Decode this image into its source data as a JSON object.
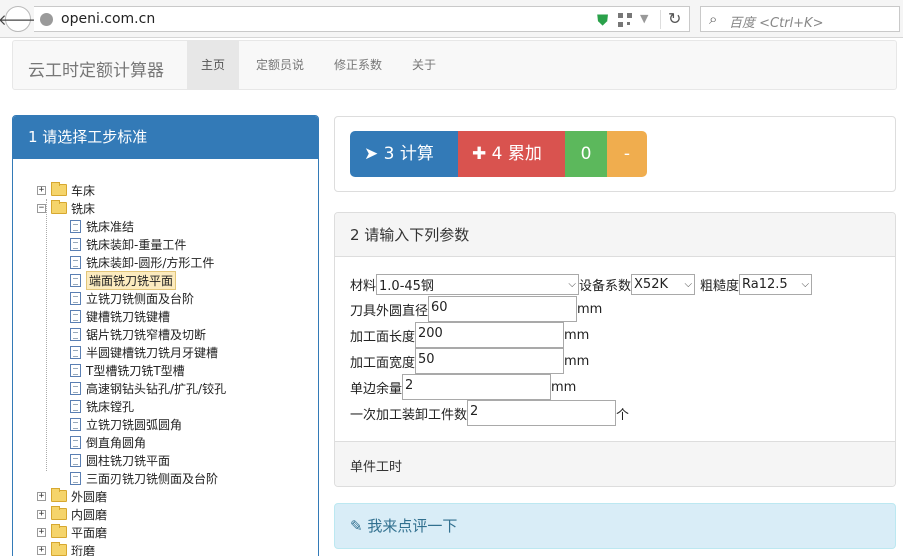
{
  "browser": {
    "url": "openi.com.cn",
    "search_placeholder": "百度 <Ctrl+K>"
  },
  "navbar": {
    "brand": "云工时定额计算器",
    "items": [
      "主页",
      "定额员说",
      "修正系数",
      "关于"
    ],
    "active_index": 0
  },
  "left": {
    "title": "1 请选择工步标准",
    "tree": [
      {
        "label": "车床",
        "type": "folder",
        "expanded": false
      },
      {
        "label": "铣床",
        "type": "folder",
        "expanded": true
      },
      {
        "label": "铣床准结",
        "type": "leaf"
      },
      {
        "label": "铣床装卸-重量工件",
        "type": "leaf"
      },
      {
        "label": "铣床装卸-圆形/方形工件",
        "type": "leaf"
      },
      {
        "label": "端面铣刀铣平面",
        "type": "leaf",
        "selected": true
      },
      {
        "label": "立铣刀铣侧面及台阶",
        "type": "leaf"
      },
      {
        "label": "键槽铣刀铣键槽",
        "type": "leaf"
      },
      {
        "label": "锯片铣刀铣窄槽及切断",
        "type": "leaf"
      },
      {
        "label": "半圆键槽铣刀铣月牙键槽",
        "type": "leaf"
      },
      {
        "label": "T型槽铣刀铣T型槽",
        "type": "leaf"
      },
      {
        "label": "高速钢钻头钻孔/扩孔/铰孔",
        "type": "leaf"
      },
      {
        "label": "铣床镗孔",
        "type": "leaf"
      },
      {
        "label": "立铣刀铣圆弧圆角",
        "type": "leaf"
      },
      {
        "label": "倒直角圆角",
        "type": "leaf"
      },
      {
        "label": "圆柱铣刀铣平面",
        "type": "leaf"
      },
      {
        "label": "三面刃铣刀铣侧面及台阶",
        "type": "leaf"
      },
      {
        "label": "外圆磨",
        "type": "folder",
        "expanded": false
      },
      {
        "label": "内圆磨",
        "type": "folder",
        "expanded": false
      },
      {
        "label": "平面磨",
        "type": "folder",
        "expanded": false
      },
      {
        "label": "珩磨",
        "type": "folder",
        "expanded": false
      }
    ]
  },
  "calc": {
    "calc_label": "3 计算",
    "add_label": "4 累加",
    "count": "0",
    "minus_label": "-"
  },
  "params": {
    "title": "2 请输入下列参数",
    "material_label": "材料",
    "material_value": "1.0-45钢",
    "equip_label": "设备系数",
    "equip_value": "X52K",
    "rough_label": "粗糙度",
    "rough_value": "Ra12.5",
    "diameter_label": "刀具外圆直径",
    "diameter_value": "60",
    "length_label": "加工面长度",
    "length_value": "200",
    "width_label": "加工面宽度",
    "width_value": "50",
    "allowance_label": "单边余量",
    "allowance_value": "2",
    "pieces_label": "一次加工装卸工件数",
    "pieces_value": "2",
    "unit_mm": "mm",
    "unit_piece": "个",
    "footer": "单件工时"
  },
  "comment": {
    "label": "我来点评一下"
  }
}
